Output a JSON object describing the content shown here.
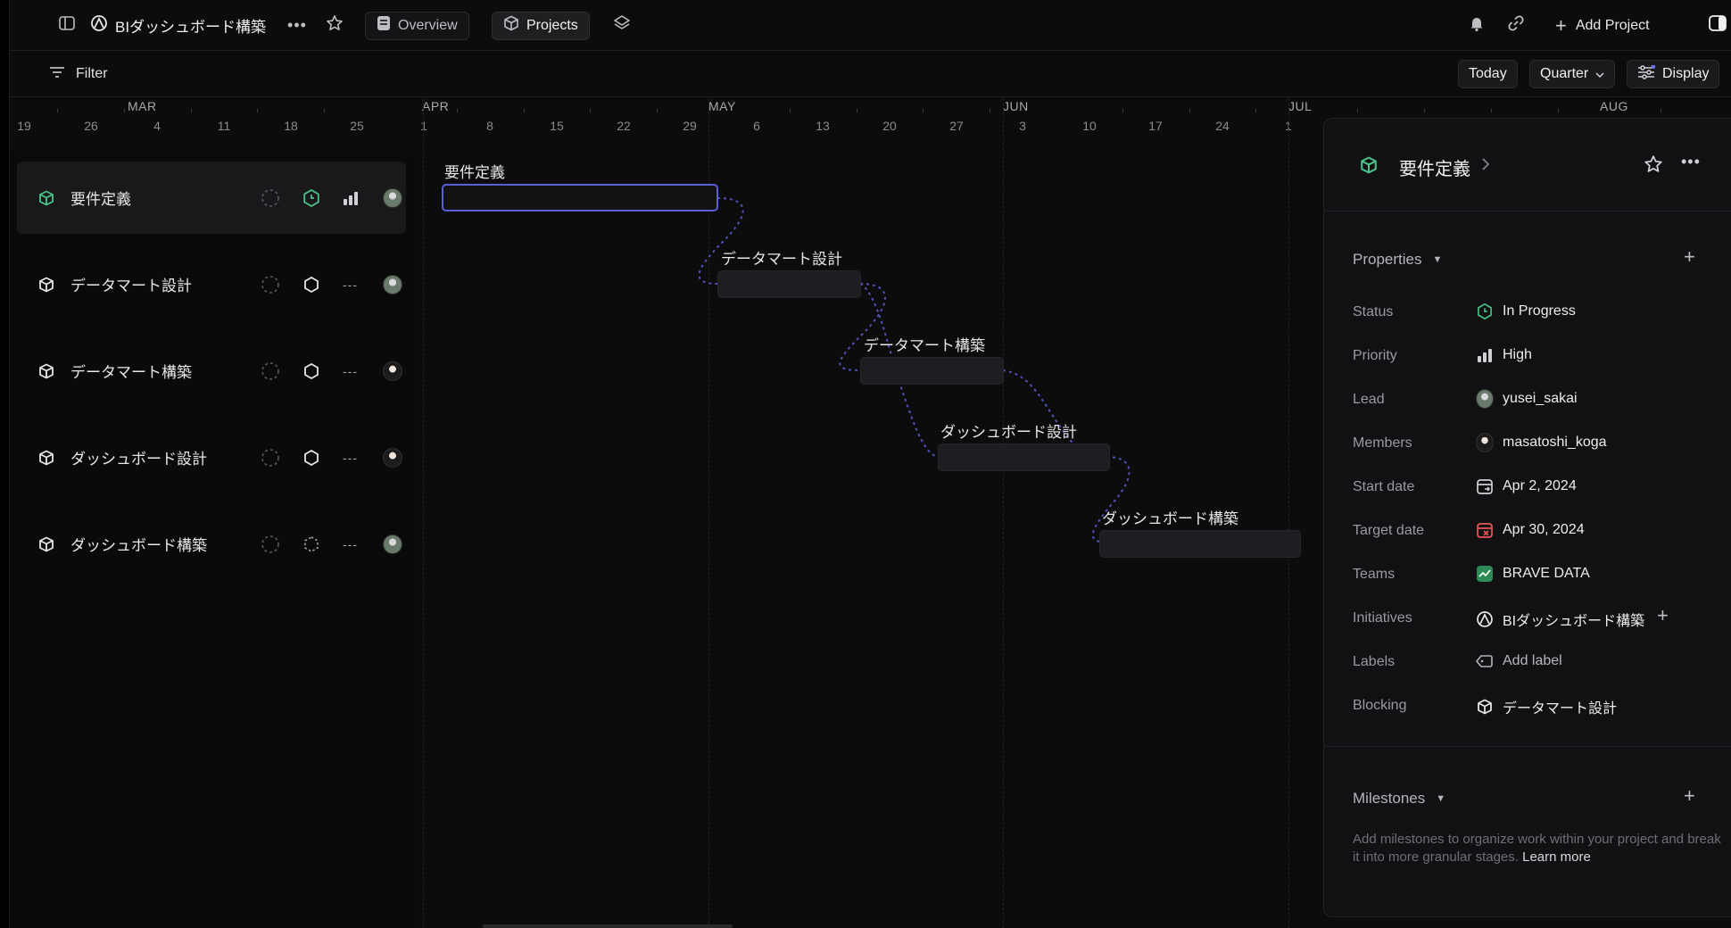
{
  "topbar": {
    "initiative_title": "BIダッシュボード構築",
    "overview_label": "Overview",
    "projects_label": "Projects",
    "add_project_label": "Add Project"
  },
  "filterbar": {
    "filter_label": "Filter",
    "today_label": "Today",
    "quarter_label": "Quarter",
    "display_label": "Display"
  },
  "timeline": {
    "months": [
      "MAR",
      "APR",
      "MAY",
      "JUN",
      "JUL",
      "AUG"
    ],
    "days": [
      "19",
      "26",
      "4",
      "11",
      "18",
      "25",
      "1",
      "8",
      "15",
      "22",
      "29",
      "6",
      "13",
      "20",
      "27",
      "3",
      "10",
      "17",
      "24",
      "1"
    ]
  },
  "projects": [
    {
      "name": "要件定義",
      "status": "in-progress",
      "priority": "high"
    },
    {
      "name": "データマート設計",
      "status": "planned",
      "priority": "none"
    },
    {
      "name": "データマート構築",
      "status": "planned",
      "priority": "none"
    },
    {
      "name": "ダッシュボード設計",
      "status": "planned",
      "priority": "none"
    },
    {
      "name": "ダッシュボード構築",
      "status": "backlog",
      "priority": "none"
    }
  ],
  "panel": {
    "title": "要件定義",
    "properties_label": "Properties",
    "properties": {
      "status": {
        "label": "Status",
        "value": "In Progress"
      },
      "priority": {
        "label": "Priority",
        "value": "High"
      },
      "lead": {
        "label": "Lead",
        "value": "yusei_sakai"
      },
      "members": {
        "label": "Members",
        "value": "masatoshi_koga"
      },
      "start_date": {
        "label": "Start date",
        "value": "Apr 2, 2024"
      },
      "target_date": {
        "label": "Target date",
        "value": "Apr 30, 2024"
      },
      "teams": {
        "label": "Teams",
        "value": "BRAVE DATA"
      },
      "initiatives": {
        "label": "Initiatives",
        "value": "BIダッシュボード構築"
      },
      "labels": {
        "label": "Labels",
        "value": "Add label"
      },
      "blocking": {
        "label": "Blocking",
        "value": "データマート設計"
      }
    },
    "milestones_label": "Milestones",
    "milestones_help": "Add milestones to organize work within your project and break it into more granular stages.",
    "learn_more": "Learn more"
  },
  "colors": {
    "accent": "#5b5fd6",
    "in_progress": "#4cc38a",
    "target_date": "#eb5757",
    "team": "#2e8b57"
  }
}
